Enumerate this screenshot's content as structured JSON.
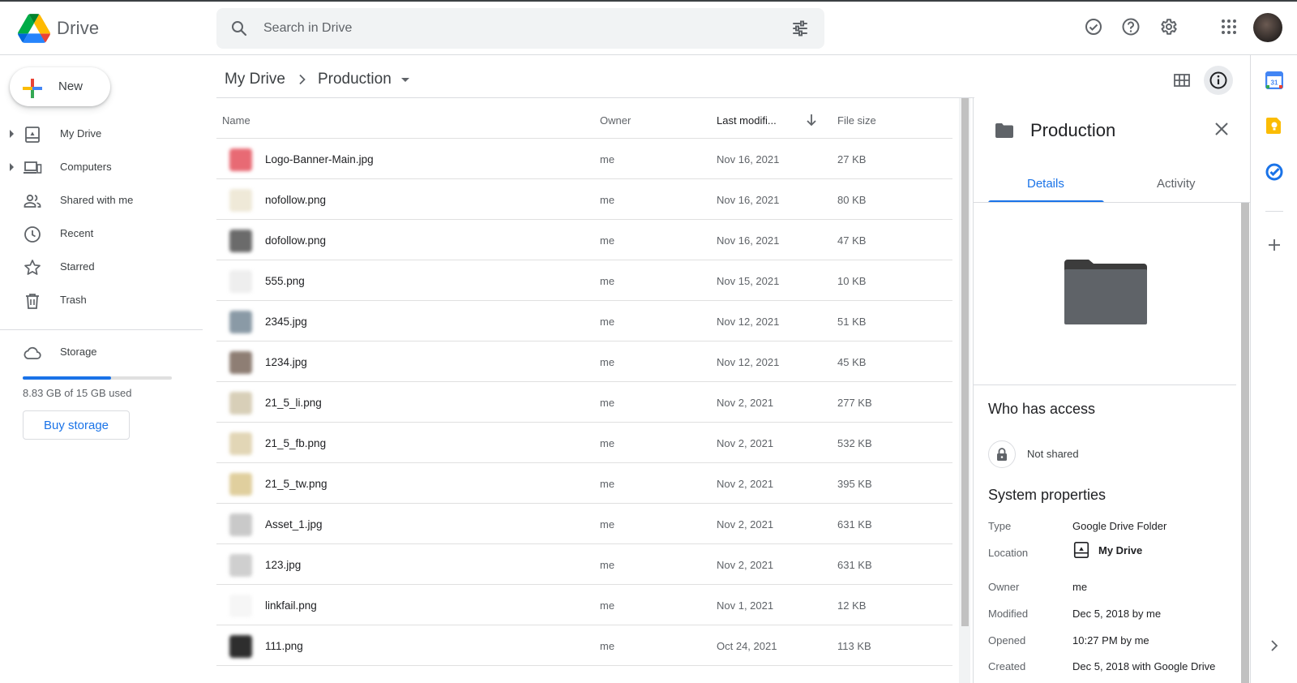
{
  "header": {
    "app_name": "Drive",
    "search_placeholder": "Search in Drive"
  },
  "sidebar": {
    "new_label": "New",
    "items": [
      {
        "label": "My Drive",
        "expandable": true,
        "icon": "my-drive-icon"
      },
      {
        "label": "Computers",
        "expandable": true,
        "icon": "computer-icon"
      },
      {
        "label": "Shared with me",
        "expandable": false,
        "icon": "people-icon"
      },
      {
        "label": "Recent",
        "expandable": false,
        "icon": "clock-icon"
      },
      {
        "label": "Starred",
        "expandable": false,
        "icon": "star-icon"
      },
      {
        "label": "Trash",
        "expandable": false,
        "icon": "trash-icon"
      }
    ],
    "storage_label": "Storage",
    "storage_used_text": "8.83 GB of 15 GB used",
    "storage_fraction": 0.59,
    "buy_storage_label": "Buy storage"
  },
  "breadcrumb": {
    "root": "My Drive",
    "current": "Production"
  },
  "table": {
    "columns": {
      "name": "Name",
      "owner": "Owner",
      "modified": "Last modifi...",
      "size": "File size"
    },
    "rows": [
      {
        "name": "Logo-Banner-Main.jpg",
        "owner": "me",
        "modified": "Nov 16, 2021",
        "size": "27 KB",
        "thumb_color": "#e86a74"
      },
      {
        "name": "nofollow.png",
        "owner": "me",
        "modified": "Nov 16, 2021",
        "size": "80 KB",
        "thumb_color": "#efe9d8"
      },
      {
        "name": "dofollow.png",
        "owner": "me",
        "modified": "Nov 16, 2021",
        "size": "47 KB",
        "thumb_color": "#6b6b6b"
      },
      {
        "name": "555.png",
        "owner": "me",
        "modified": "Nov 15, 2021",
        "size": "10 KB",
        "thumb_color": "#eeeeee"
      },
      {
        "name": "2345.jpg",
        "owner": "me",
        "modified": "Nov 12, 2021",
        "size": "51 KB",
        "thumb_color": "#8a9aa6"
      },
      {
        "name": "1234.jpg",
        "owner": "me",
        "modified": "Nov 12, 2021",
        "size": "45 KB",
        "thumb_color": "#8e7e74"
      },
      {
        "name": "21_5_li.png",
        "owner": "me",
        "modified": "Nov 2, 2021",
        "size": "277 KB",
        "thumb_color": "#d8cfb8"
      },
      {
        "name": "21_5_fb.png",
        "owner": "me",
        "modified": "Nov 2, 2021",
        "size": "532 KB",
        "thumb_color": "#e2d6b6"
      },
      {
        "name": "21_5_tw.png",
        "owner": "me",
        "modified": "Nov 2, 2021",
        "size": "395 KB",
        "thumb_color": "#e0cf9e"
      },
      {
        "name": "Asset_1.jpg",
        "owner": "me",
        "modified": "Nov 2, 2021",
        "size": "631 KB",
        "thumb_color": "#c9c9c9"
      },
      {
        "name": "123.jpg",
        "owner": "me",
        "modified": "Nov 2, 2021",
        "size": "631 KB",
        "thumb_color": "#cfcfcf"
      },
      {
        "name": "linkfail.png",
        "owner": "me",
        "modified": "Nov 1, 2021",
        "size": "12 KB",
        "thumb_color": "#f6f6f6"
      },
      {
        "name": "111.png",
        "owner": "me",
        "modified": "Oct 24, 2021",
        "size": "113 KB",
        "thumb_color": "#2e2e2e"
      }
    ]
  },
  "details": {
    "title": "Production",
    "tabs": [
      "Details",
      "Activity"
    ],
    "active_tab": "Details",
    "who_has_access_title": "Who has access",
    "access_text": "Not shared",
    "system_properties_title": "System properties",
    "properties": [
      {
        "label": "Type",
        "value": "Google Drive Folder"
      },
      {
        "label": "Location",
        "value": "My Drive"
      },
      {
        "label": "Owner",
        "value": "me"
      },
      {
        "label": "Modified",
        "value": "Dec 5, 2018 by me"
      },
      {
        "label": "Opened",
        "value": "10:27 PM by me"
      },
      {
        "label": "Created",
        "value": "Dec 5, 2018 with Google Drive"
      }
    ]
  },
  "colors": {
    "accent": "#1a73e8",
    "calendar": "#4285f4",
    "keep": "#fbbc04",
    "tasks": "#1a73e8"
  }
}
